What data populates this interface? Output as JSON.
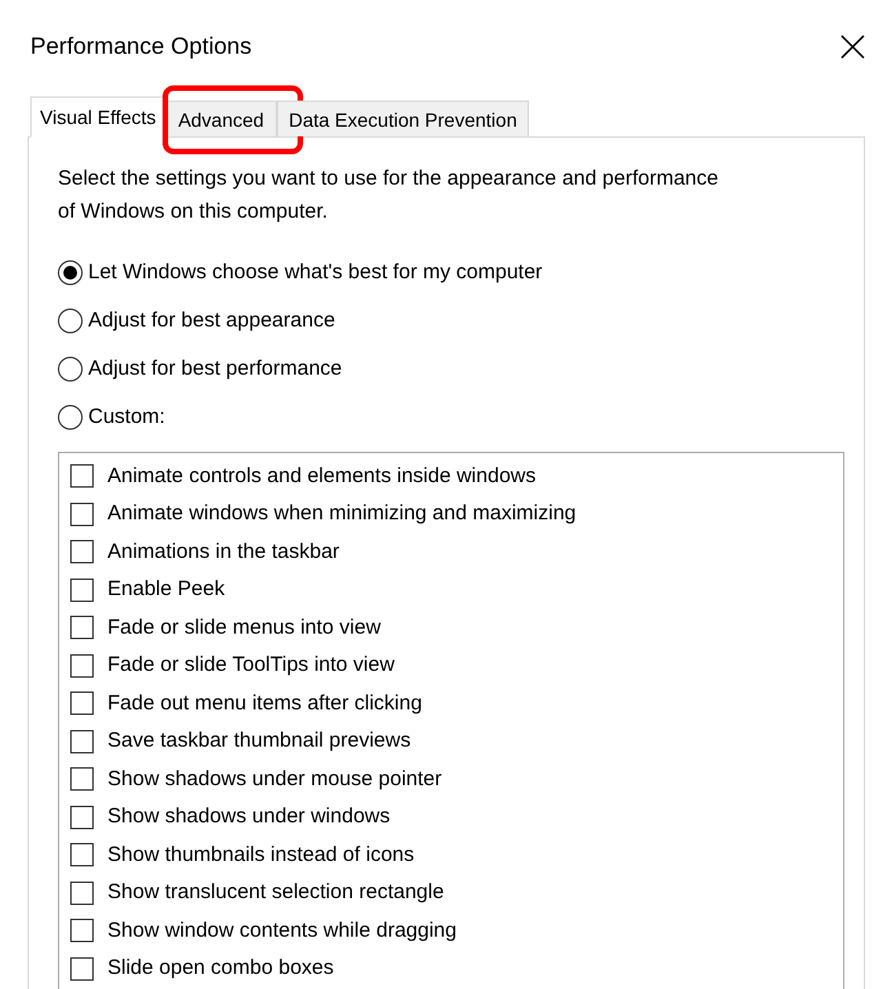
{
  "window": {
    "title": "Performance Options"
  },
  "tabs": [
    {
      "label": "Visual Effects",
      "selected": true,
      "highlighted": false
    },
    {
      "label": "Advanced",
      "selected": false,
      "highlighted": true
    },
    {
      "label": "Data Execution Prevention",
      "selected": false,
      "highlighted": false
    }
  ],
  "description": "Select the settings you want to use for the appearance and performance of Windows on this computer.",
  "options": [
    {
      "label": "Let Windows choose what's best for my computer",
      "selected": true
    },
    {
      "label": "Adjust for best appearance",
      "selected": false
    },
    {
      "label": "Adjust for best performance",
      "selected": false
    },
    {
      "label": "Custom:",
      "selected": false
    }
  ],
  "settings": [
    {
      "label": "Animate controls and elements inside windows",
      "checked": false
    },
    {
      "label": "Animate windows when minimizing and maximizing",
      "checked": false
    },
    {
      "label": "Animations in the taskbar",
      "checked": false
    },
    {
      "label": "Enable Peek",
      "checked": false
    },
    {
      "label": "Fade or slide menus into view",
      "checked": false
    },
    {
      "label": "Fade or slide ToolTips into view",
      "checked": false
    },
    {
      "label": "Fade out menu items after clicking",
      "checked": false
    },
    {
      "label": "Save taskbar thumbnail previews",
      "checked": false
    },
    {
      "label": "Show shadows under mouse pointer",
      "checked": false
    },
    {
      "label": "Show shadows under windows",
      "checked": false
    },
    {
      "label": "Show thumbnails instead of icons",
      "checked": false
    },
    {
      "label": "Show translucent selection rectangle",
      "checked": false
    },
    {
      "label": "Show window contents while dragging",
      "checked": false
    },
    {
      "label": "Slide open combo boxes",
      "checked": false
    }
  ]
}
